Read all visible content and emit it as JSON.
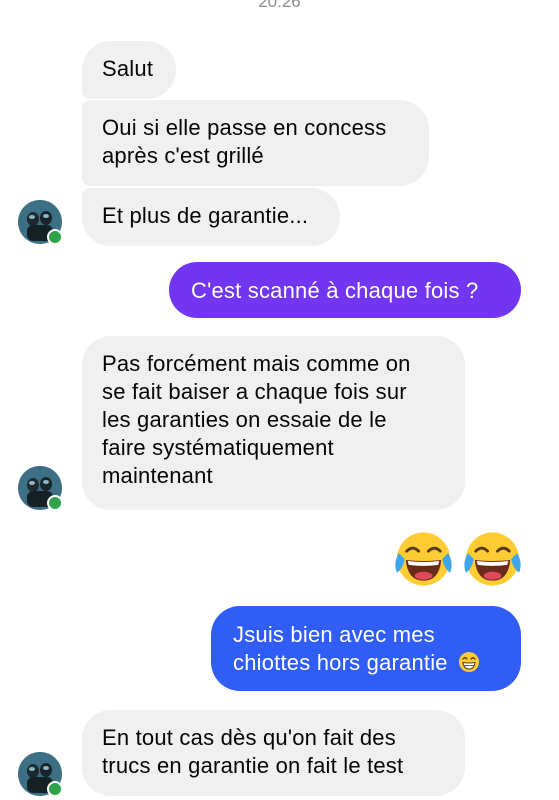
{
  "chat": {
    "timestamp": "20:26",
    "messages": [
      {
        "id": "salut",
        "direction": "incoming",
        "text": "Salut"
      },
      {
        "id": "oui",
        "direction": "incoming",
        "text": "Oui si elle passe en concess\naprès c'est grillé"
      },
      {
        "id": "plus",
        "direction": "incoming",
        "text": "Et plus de garantie..."
      },
      {
        "id": "scan",
        "direction": "outgoing",
        "text": "C'est scanné à chaque fois ?"
      },
      {
        "id": "pas",
        "direction": "incoming",
        "text": "Pas forcément mais comme on\nse fait baiser a chaque fois sur\nles garanties on essaie de le\nfaire systématiquement\nmaintenant"
      },
      {
        "id": "emoji",
        "direction": "outgoing",
        "emoji": [
          "face-with-tears-of-joy",
          "face-with-tears-of-joy"
        ]
      },
      {
        "id": "jsuis",
        "direction": "outgoing",
        "text": "Jsuis bien avec mes\nchiottes hors garantie",
        "trailing_emoji": "grinning-face-with-smiling-eyes"
      },
      {
        "id": "entout",
        "direction": "incoming",
        "text": "En tout cas dès qu'on fait des\ntrucs en garantie on fait le test"
      }
    ]
  },
  "colors": {
    "incoming_bubble": "#f0f0f0",
    "outgoing_purple": "#7236f3",
    "outgoing_blue": "#2f5df6",
    "presence_online": "#31a24c"
  },
  "icons": {
    "avatar": "contact-avatar",
    "presence": "online-presence-dot"
  }
}
